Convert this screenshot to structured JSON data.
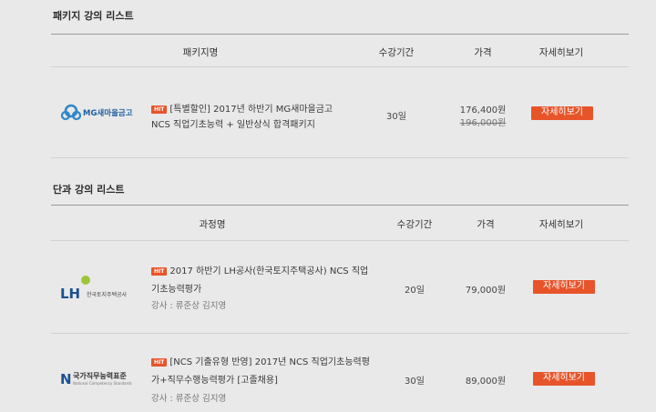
{
  "package_section": {
    "title": "패키지 강의 리스트",
    "headers": {
      "name": "패키지명",
      "period": "수강기간",
      "price": "가격",
      "detail": "자세히보기"
    },
    "rows": [
      {
        "logo_text": "MG새마을금고",
        "badge": "HIT",
        "title_line1": "[특별할인] 2017년 하반기 MG새마을금고",
        "title_line2": "NCS 직업기초능력 + 일반상식 합격패키지",
        "period": "30일",
        "price": "176,400원",
        "original_price": "196,000원",
        "button": "자세히보기"
      }
    ]
  },
  "single_section": {
    "title": "단과 강의 리스트",
    "headers": {
      "name": "과정명",
      "period": "수강기간",
      "price": "가격",
      "detail": "자세히보기"
    },
    "rows": [
      {
        "logo_mark": "LH",
        "logo_text": "한국토지주택공사",
        "badge": "HIT",
        "title_line1": "2017 하반기 LH공사(한국토지주택공사) NCS 직업",
        "title_line2": "기초능력평가",
        "instructor": "강사 : 류준상 김지영",
        "period": "20일",
        "price": "79,000원",
        "button": "자세히보기"
      },
      {
        "logo_mark": "N",
        "logo_text": "국가직무능력표준",
        "logo_subtext": "National Competency Standards",
        "badge": "HIT",
        "title_line1": "[NCS 기출유형 반영] 2017년 NCS 직업기초능력평",
        "title_line2": "가+직무수행능력평가 [고졸채용]",
        "instructor": "강사 : 류준상 김지영",
        "period": "30일",
        "price": "89,000원",
        "button": "자세히보기"
      }
    ]
  },
  "colors": {
    "accent": "#e8542a",
    "background": "#e9e9e9",
    "mg_blue": "#2f88c9",
    "lh_green": "#9cc63a",
    "lh_navy": "#1d4f91"
  }
}
